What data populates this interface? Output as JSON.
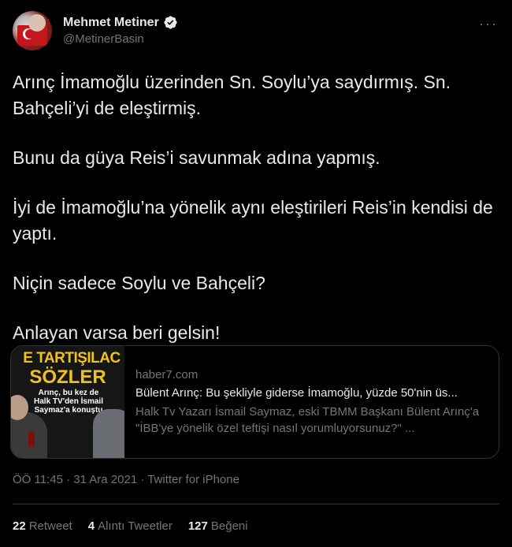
{
  "author": {
    "display_name": "Mehmet Metiner",
    "handle": "@MetinerBasin"
  },
  "more_label": "···",
  "tweet": {
    "paragraphs": [
      "Arınç İmamoğlu üzerinden Sn. Soylu’ya saydırmış. Sn. Bahçeli’yi de eleştirmiş.",
      "Bunu da güya Reis’i savunmak adına yapmış.",
      "İyi de İmamoğlu’na yönelik aynı eleştirileri Reis’in kendisi de yaptı.",
      "Niçin sadece Soylu ve Bahçeli?",
      "Anlayan varsa beri gelsin!"
    ]
  },
  "card": {
    "thumb_line1": "E TARTIŞILAC",
    "thumb_line2": "SÖZLER",
    "thumb_caption": "Arınç, bu kez de Halk TV'den İsmail Saymaz'a konuştu",
    "domain": "haber7.com",
    "title": "Bülent Arınç: Bu şekliyle giderse İmamoğlu, yüzde 50'nin üs...",
    "description": "Halk Tv Yazarı İsmail Saymaz, eski TBMM Başkanı Bülent Arınç'a \"İBB'ye yönelik özel teftişi nasıl yorumluyorsunuz?\" ..."
  },
  "meta": "ÖÖ 11:45 · 31 Ara 2021 · Twitter for iPhone",
  "stats": {
    "retweets_count": "22",
    "retweets_label": "Retweet",
    "quotes_count": "4",
    "quotes_label": "Alıntı Tweetler",
    "likes_count": "127",
    "likes_label": "Beğeni"
  },
  "colors": {
    "background": "#000000",
    "text": "#e7e9ea",
    "secondary": "#71767b",
    "verified": "#e7e9ea"
  }
}
